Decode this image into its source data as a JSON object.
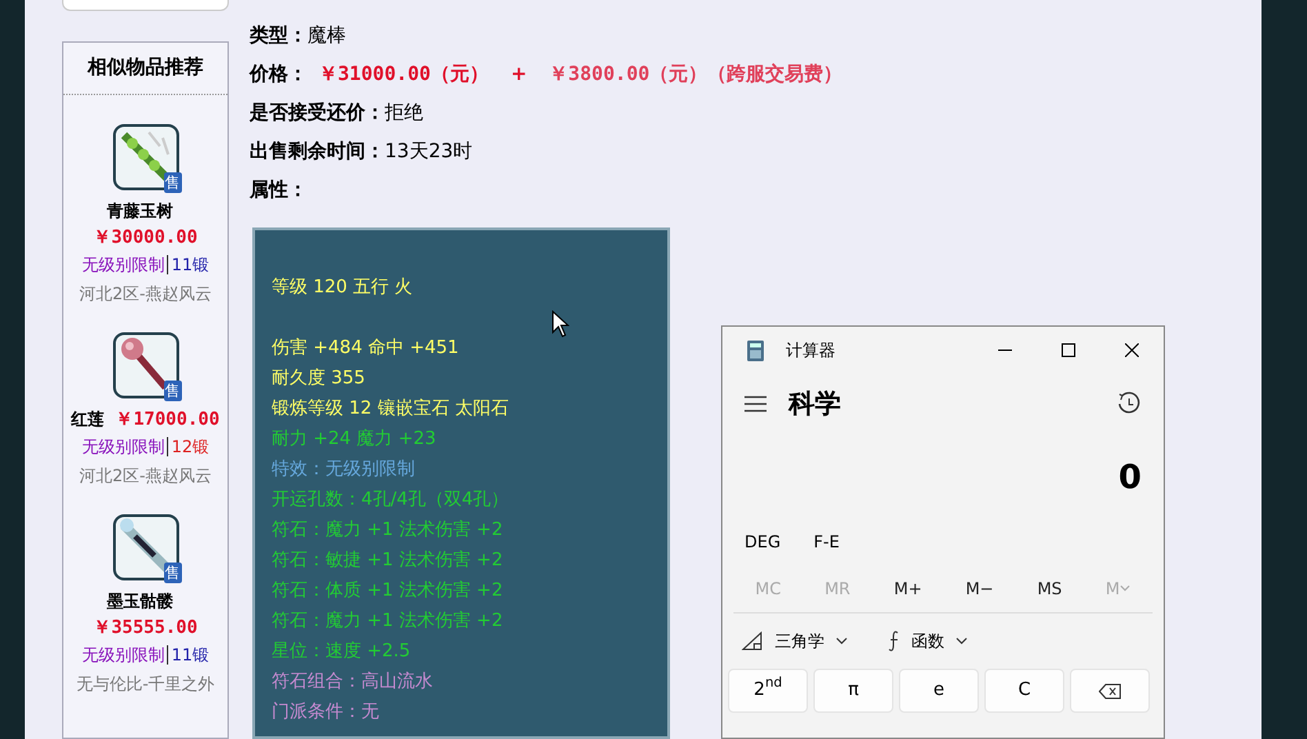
{
  "details": {
    "rows": [
      {
        "label": "类型：",
        "value": "魔棒",
        "kind": "plain"
      },
      {
        "label": "价格：",
        "value": "￥31000.00（元）",
        "plus": "+",
        "extra": "￥3800.00（元）（跨服交易费）",
        "kind": "price"
      },
      {
        "label": "是否接受还价：",
        "value": "拒绝",
        "kind": "plain"
      },
      {
        "label": "出售剩余时间：",
        "value": "13天23时",
        "kind": "plain"
      },
      {
        "label": "属性：",
        "kind": "plain"
      }
    ]
  },
  "tooltip": {
    "lines": [
      {
        "text": "等级 120 五行 火",
        "color": "#ffff66"
      },
      {
        "text": "伤害 +484 命中 +451",
        "color": "#ffff66",
        "spacer_before": true
      },
      {
        "text": "耐久度 355",
        "color": "#ffff66"
      },
      {
        "text": "锻炼等级 12 镶嵌宝石 太阳石",
        "color": "#ffff66"
      },
      {
        "text": "耐力 +24 魔力 +23",
        "color": "#22cc33"
      },
      {
        "text": "特效：无级别限制",
        "color": "#66a8dd"
      },
      {
        "text": "开运孔数：4孔/4孔（双4孔）",
        "color": "#22cc33"
      },
      {
        "text": "符石：魔力 +1 法术伤害 +2",
        "color": "#22cc33"
      },
      {
        "text": "符石：敏捷 +1 法术伤害 +2",
        "color": "#22cc33"
      },
      {
        "text": "符石：体质 +1 法术伤害 +2",
        "color": "#22cc33"
      },
      {
        "text": "符石：魔力 +1 法术伤害 +2",
        "color": "#22cc33"
      },
      {
        "text": "星位：速度 +2.5",
        "color": "#22cc33"
      },
      {
        "text": "符石组合：高山流水",
        "color": "#c58ad0"
      },
      {
        "text": "门派条件：无",
        "color": "#c58ad0"
      }
    ]
  },
  "similar": {
    "title": "相似物品推荐",
    "items": [
      {
        "name": "青藤玉树",
        "badge": "售",
        "price": "￥30000.00",
        "limit": "无级别限制",
        "forge": "11锻",
        "color": "#2222aa",
        "server": "河北2区-燕赵风云",
        "kind": "branch"
      },
      {
        "name": "红莲",
        "badge": "售",
        "price": "￥17000.00",
        "limit": "无级别限制",
        "forge": "12锻",
        "color": "#dd2222",
        "server": "河北2区-燕赵风云",
        "kind": "staff"
      },
      {
        "name": "墨玉骷髅",
        "badge": "售",
        "price": "￥35555.00",
        "limit": "无级别限制",
        "forge": "11锻",
        "color": "#2222aa",
        "server": "无与伦比-千里之外",
        "kind": "wand"
      }
    ]
  },
  "calculator": {
    "title": "计算器",
    "mode": "科学",
    "display": "0",
    "modes": [
      "DEG",
      "F-E"
    ],
    "memory": [
      {
        "label": "MC",
        "disabled": true
      },
      {
        "label": "MR",
        "disabled": true
      },
      {
        "label": "M+",
        "disabled": false
      },
      {
        "label": "M−",
        "disabled": false
      },
      {
        "label": "MS",
        "disabled": false
      },
      {
        "label": "M",
        "disabled": true
      }
    ],
    "menus": [
      {
        "label": "三角学",
        "kind": "trig"
      },
      {
        "label": "函数",
        "kind": "func"
      }
    ],
    "keys": [
      {
        "label": "2$^{nd}$",
        "kind": "text"
      },
      {
        "label": "π",
        "kind": "text"
      },
      {
        "label": "e",
        "kind": "text"
      },
      {
        "label": "C",
        "kind": "text"
      },
      {
        "kind": "backspace"
      }
    ]
  }
}
